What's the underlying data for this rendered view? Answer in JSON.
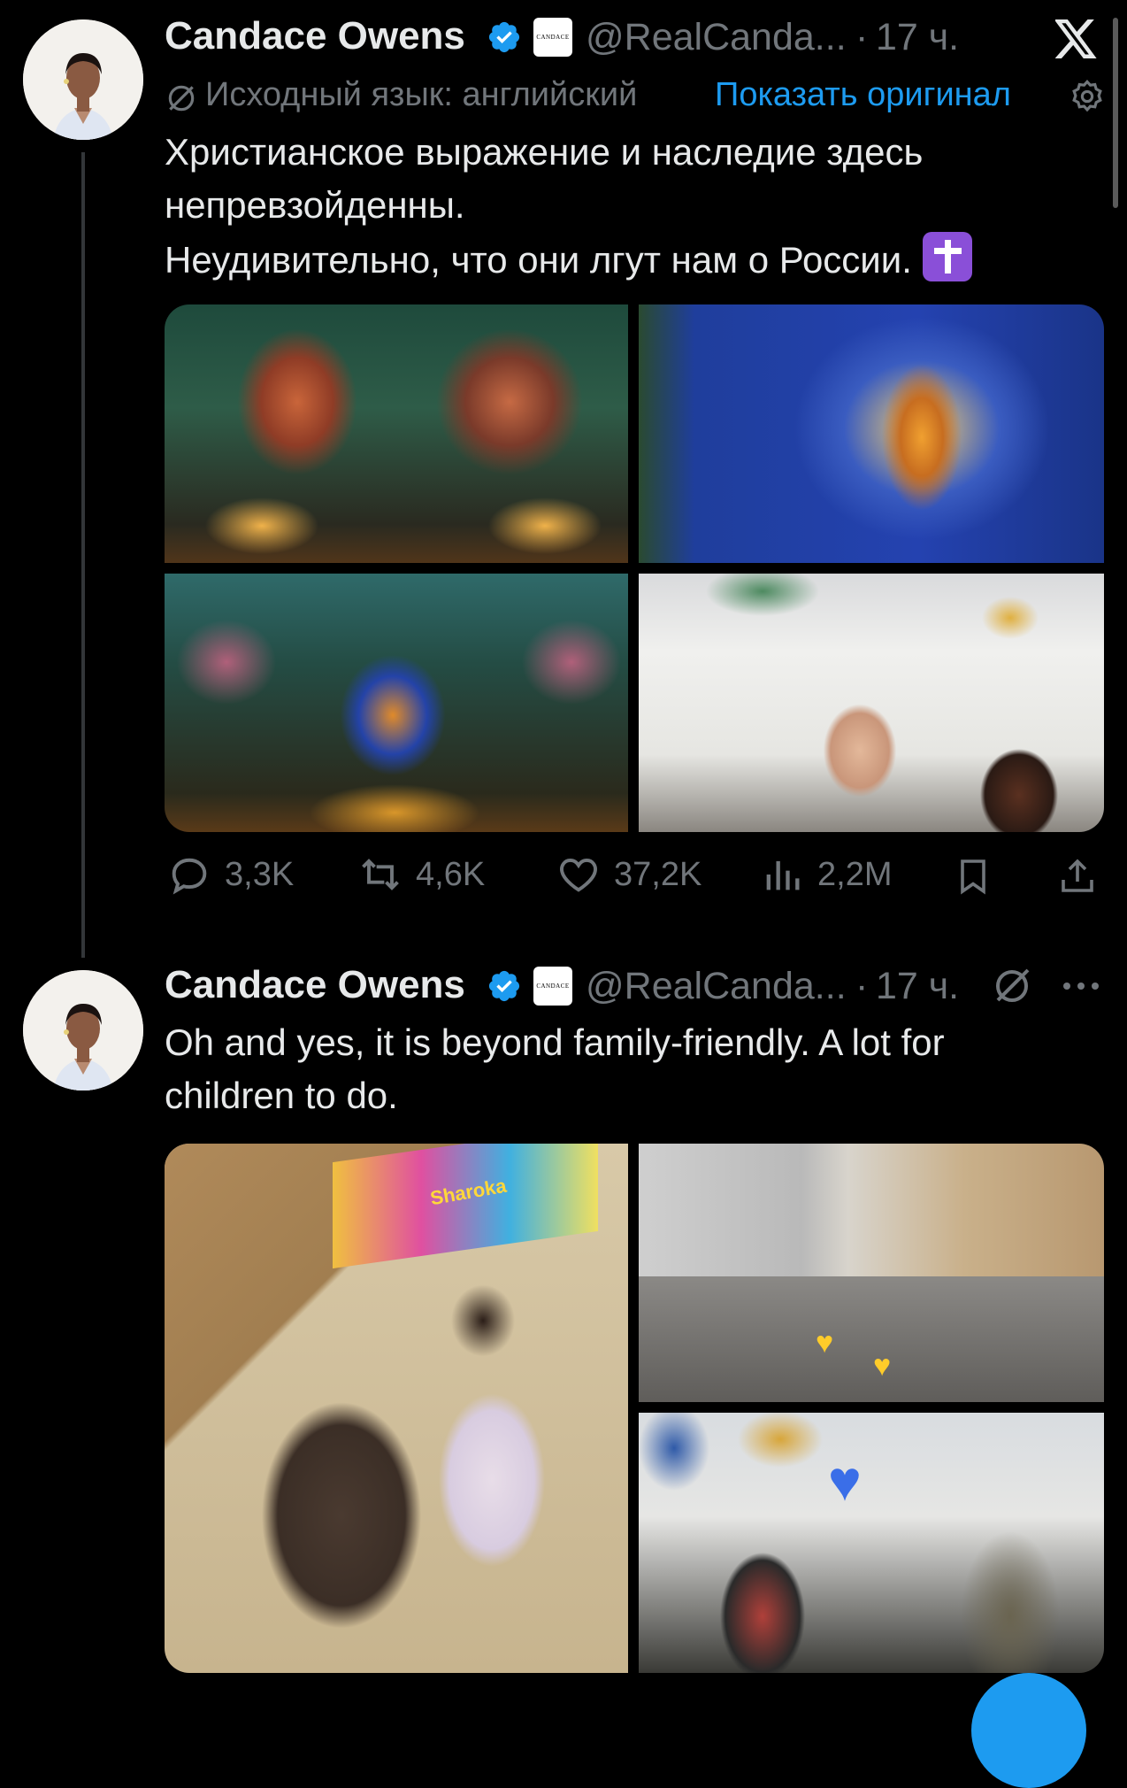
{
  "tweet1": {
    "name": "Candace Owens",
    "handle": "@RealCanda...",
    "separator": "·",
    "time": "17 ч.",
    "affiliate_text": "CANDACE",
    "translation_note": "Исходный язык: английский",
    "show_original": "Показать оригинал",
    "text_line1": "Христианское выражение и наследие здесь",
    "text_line2": "непревзойденны.",
    "text_line3": "Неудивительно, что они лгут нам о России.",
    "actions": {
      "replies": "3,3K",
      "reposts": "4,6K",
      "likes": "37,2K",
      "views": "2,2M"
    }
  },
  "tweet2": {
    "name": "Candace Owens",
    "handle": "@RealCanda...",
    "separator": "·",
    "time": "17 ч.",
    "affiliate_text": "CANDACE",
    "text_line1": "Oh and yes, it is beyond family-friendly. A lot for",
    "text_line2": "children to do.",
    "image_text": "Sharoka"
  },
  "icons": {
    "close": "x-logo-icon",
    "settings": "gear-icon",
    "more": "more-dots-icon",
    "translate": "translate-slash-icon",
    "verified": "verified-badge-icon"
  },
  "colors": {
    "background": "#000000",
    "text": "#e7e9ea",
    "muted": "#71767b",
    "link": "#1d9bf0",
    "badge": "#1d9bf0"
  }
}
